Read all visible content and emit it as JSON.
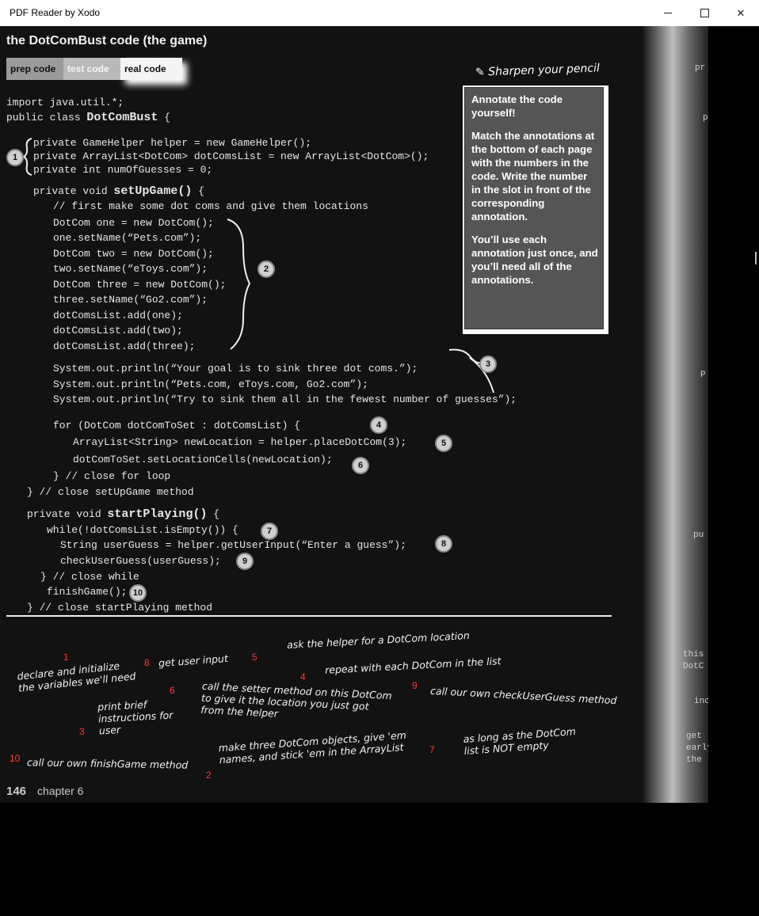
{
  "window": {
    "title": "PDF Reader by Xodo"
  },
  "page": {
    "heading_prefix": "the ",
    "heading_name": "DotComBust",
    "heading_suffix": " code (the game)",
    "tabs": [
      "prep code",
      "test code",
      "real code"
    ],
    "code_lines": [
      "import java.util.*;",
      "public class "
    ],
    "class_name": "DotComBust",
    "class_tail": " {",
    "fields": [
      "private GameHelper helper = new GameHelper();",
      "private ArrayList<DotCom> dotComsList = new ArrayList<DotCom>();",
      "private int numOfGuesses = 0;"
    ],
    "setup_sig_pre": "private void ",
    "setup_sig_name": "setUpGame()",
    "setup_sig_post": " {",
    "setup_body": [
      "// first make some dot coms and give them locations",
      "DotCom one = new DotCom();",
      "one.setName(“Pets.com”);",
      "DotCom two = new DotCom();",
      "two.setName(“eToys.com”);",
      "DotCom three = new DotCom();",
      "three.setName(“Go2.com”);",
      "dotComsList.add(one);",
      "dotComsList.add(two);",
      "dotComsList.add(three);"
    ],
    "prints": [
      "System.out.println(“Your goal is to sink three dot coms.”);",
      "System.out.println(“Pets.com, eToys.com, Go2.com”);",
      "System.out.println(“Try to sink them all in the fewest number of guesses”);"
    ],
    "for_line": "for (DotCom dotComToSet : dotComsList) {",
    "for_body": [
      "ArrayList<String> newLocation = helper.placeDotCom(3);",
      "dotComToSet.setLocationCells(newLocation);"
    ],
    "close_for": "} // close for loop",
    "close_setup": "} // close setUpGame method",
    "play_sig_pre": "private void ",
    "play_sig_name": "startPlaying()",
    "play_sig_post": " {",
    "while_line": "while(!dotComsList.isEmpty()) {",
    "while_body": [
      "String userGuess = helper.getUserInput(“Enter a guess”);",
      "checkUserGuess(userGuess);"
    ],
    "close_while": "} // close while",
    "finish_line": "finishGame();",
    "close_play": "} // close startPlaying method",
    "markers": [
      "1",
      "2",
      "3",
      "4",
      "5",
      "6",
      "7",
      "8",
      "9",
      "10"
    ],
    "sharpen_title": "Sharpen your pencil",
    "sharpen_paras": [
      "Annotate the code yourself!",
      "Match the annotations at the bottom of each page with the numbers in the code. Write the number in the slot in front of the corresponding annotation.",
      "You’ll use each annotation just once, and you’ll need all of the annotations."
    ],
    "annotations": [
      {
        "num": "1",
        "text": "declare and initialize\nthe variables we'll need"
      },
      {
        "num": "8",
        "text": "get user input"
      },
      {
        "num": "5",
        "text": "ask the helper for a DotCom location"
      },
      {
        "num": "4",
        "text": "repeat with each DotCom in the list"
      },
      {
        "num": "6",
        "text": "call the setter method on this DotCom\nto give it the location you just got\nfrom the helper"
      },
      {
        "num": "9",
        "text": "call our own checkUserGuess method"
      },
      {
        "num": "3",
        "text": "print brief\ninstructions for\nuser"
      },
      {
        "num": "2",
        "text": "make three DotCom objects, give 'em\nnames, and stick 'em in the ArrayList"
      },
      {
        "num": "7",
        "text": "as long as the DotCom\nlist is NOT empty"
      },
      {
        "num": "10",
        "text": "call our own finishGame method"
      }
    ],
    "page_number": "146",
    "chapter": "chapter 6",
    "next_page_fragments": [
      "pr",
      "p",
      "P",
      "pu",
      "this",
      "DotC",
      "inc",
      "get",
      "early",
      "the"
    ]
  }
}
